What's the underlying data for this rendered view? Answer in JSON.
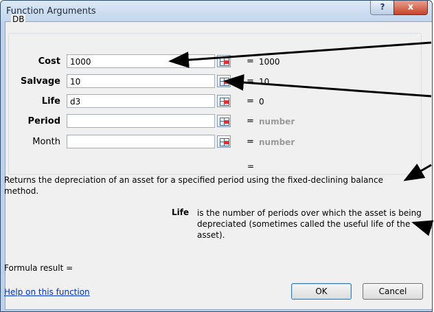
{
  "window": {
    "title": "Function Arguments",
    "help_glyph": "?",
    "close_glyph": "x"
  },
  "function_group": {
    "name": "DB"
  },
  "arguments": [
    {
      "label": "Cost",
      "bold": true,
      "value": "1000",
      "result": "1000"
    },
    {
      "label": "Salvage",
      "bold": true,
      "value": "10",
      "result": "10"
    },
    {
      "label": "Life",
      "bold": true,
      "value": "d3",
      "result": "0"
    },
    {
      "label": "Period",
      "bold": true,
      "value": "",
      "result": "number"
    },
    {
      "label": "Month",
      "bold": false,
      "value": "",
      "result": "number"
    }
  ],
  "equals_sign": "=",
  "description": "Returns the depreciation of an asset for a specified period using the fixed-declining balance method.",
  "argument_help": {
    "name": "Life",
    "text": "is the number of periods over which the asset is being depreciated (sometimes called the useful life of the asset)."
  },
  "formula_result_label": "Formula result =",
  "help_link": "Help on this function",
  "buttons": {
    "ok": "OK",
    "cancel": "Cancel"
  },
  "colors": {
    "annotation_arrow": "#000000",
    "link": "#0033cc",
    "placeholder_result": "#9a9a9a"
  }
}
